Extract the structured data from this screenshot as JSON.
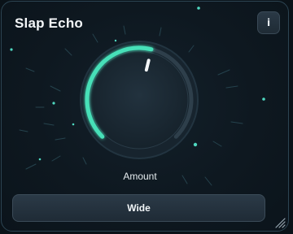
{
  "plugin": {
    "title": "Slap Echo",
    "info_label": "i"
  },
  "knob": {
    "label": "Amount",
    "value_fraction": 0.55,
    "accent_color": "#46e0b8"
  },
  "mode_button": {
    "label": "Wide"
  },
  "icons": {
    "info": "info-icon",
    "resize": "resize-grip-icon"
  }
}
